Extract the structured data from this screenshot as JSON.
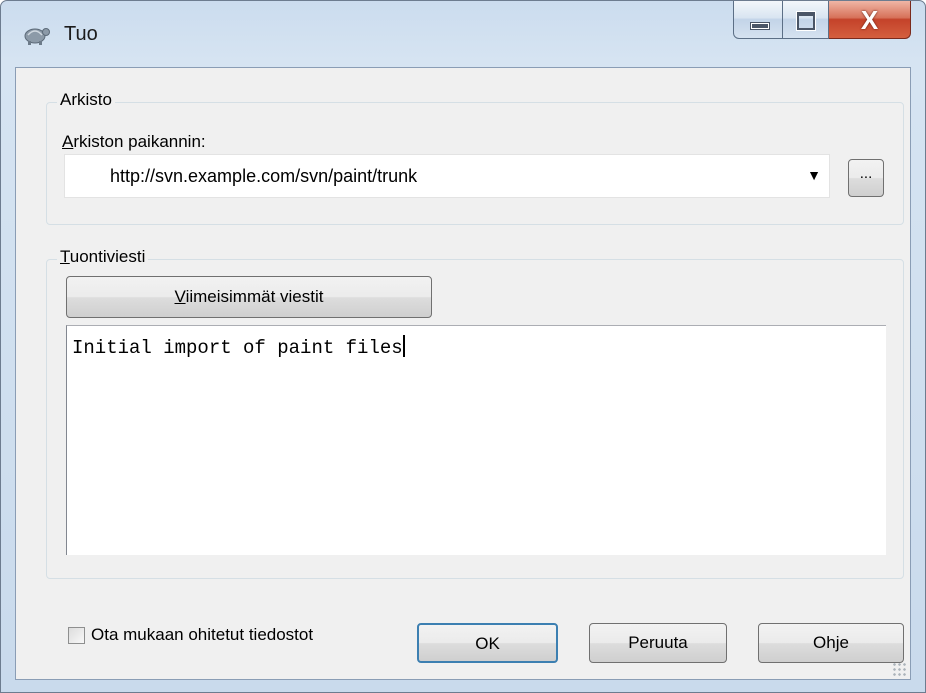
{
  "window": {
    "title": "Tuo",
    "app_icon": "tortoise-icon",
    "caption": {
      "minimize_icon": "minimize-icon",
      "maximize_icon": "maximize-icon",
      "close_icon": "close-icon",
      "close_glyph": "X"
    }
  },
  "repository": {
    "group_label": "Arkisto",
    "url_label_accel": "A",
    "url_label_rest": "rkiston paikannin:",
    "url_value": "http://svn.example.com/svn/paint/trunk",
    "dropdown_arrow": "▼",
    "browse_label": "..."
  },
  "import_message": {
    "group_label_accel": "T",
    "group_label_rest": "uontiviesti",
    "recent_button_accel": "V",
    "recent_button_rest": "iimeisimmät viestit",
    "message_text": "Initial import of paint files"
  },
  "footer": {
    "include_ignored_label": "Ota mukaan ohitetut tiedostot",
    "include_ignored_checked": false,
    "ok_label": "OK",
    "cancel_label": "Peruuta",
    "help_label": "Ohje"
  },
  "colors": {
    "ok_focus_border": "#3c7fb1",
    "close_button": "#c4422a"
  }
}
